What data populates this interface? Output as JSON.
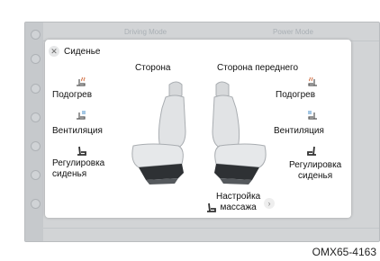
{
  "background": {
    "tab_left": "Driving Mode",
    "tab_right": "Power Mode"
  },
  "popup": {
    "title": "Сиденье",
    "driver": {
      "heading": "Сторона",
      "heat": "Подогрев",
      "vent": "Вентиляция",
      "adjust": "Регулировка\nсиденья"
    },
    "passenger": {
      "heading": "Сторона переднего",
      "heat": "Подогрев",
      "vent": "Вентиляция",
      "adjust": "Регулировка\nсиденья"
    },
    "massage": "Настройка\nмассажа"
  },
  "figure_code": "OMX65-4163",
  "icons": {
    "close": "close-icon",
    "heat": "seat-heat-icon",
    "vent": "seat-vent-icon",
    "adjust": "seat-adjust-icon",
    "massage": "seat-massage-icon",
    "next": "chevron-right-icon"
  }
}
